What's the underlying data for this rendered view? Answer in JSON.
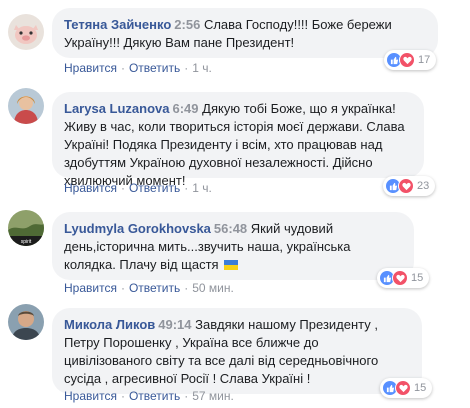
{
  "actions": {
    "like": "Нравится",
    "reply": "Ответить",
    "dot": "·"
  },
  "comments": [
    {
      "author": "Тетяна Зайченко",
      "clap": "2:56",
      "text": "Слава Господу!!!! Боже бережи Україну!!! Дякую Вам пане Президент!",
      "time": "1 ч.",
      "reactions": {
        "count": "17",
        "icons": [
          "like-icon",
          "love-icon"
        ]
      }
    },
    {
      "author": "Larysa Luzanova",
      "clap": "6:49",
      "text": "Дякую тобі Боже, що я українка! Живу в час, коли твориться історія моєї держави. Слава Україні! Подяка Президенту і всім, хто працював над здобуттям Україною духовної незалежності. Дійсно хвилюючий момент!",
      "time": "1 ч.",
      "reactions": {
        "count": "23",
        "icons": [
          "like-icon",
          "love-icon"
        ]
      }
    },
    {
      "author": "Lyudmyla Gorokhovska",
      "clap": "56:48",
      "text": "Який чудовий день,історична мить...звучить наша, українська колядка. Плачу від щастя",
      "flag": "ukraine-flag-emoji",
      "time": "50 мин.",
      "reactions": {
        "count": "15",
        "icons": [
          "like-icon",
          "love-icon"
        ]
      }
    },
    {
      "author": "Микола Ликов",
      "clap": "49:14",
      "text": "Завдяки нашому Президенту , Петру Порошенку , Україна все ближче до цивілізованого світу та все далі від середньовічного сусіда , агресивної Росії ! Слава Україні !",
      "time": "57 мин.",
      "reactions": {
        "count": "15",
        "icons": [
          "like-icon",
          "love-icon"
        ]
      }
    }
  ],
  "colors": {
    "link": "#385898",
    "bubble": "#f2f3f5",
    "meta": "#90949c",
    "like": "#5890ff",
    "love": "#f25268"
  }
}
